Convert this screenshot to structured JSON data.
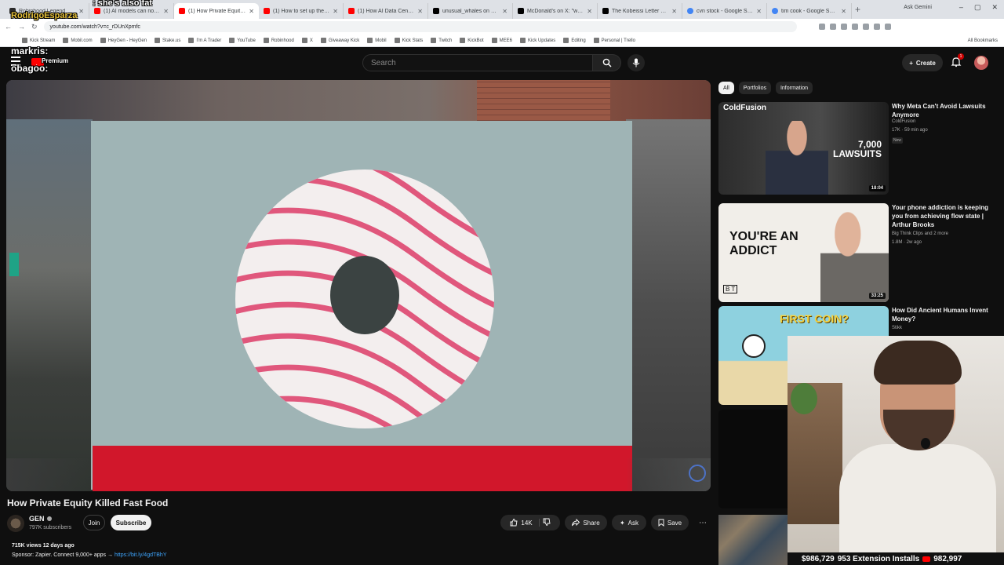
{
  "browser": {
    "tabs": [
      {
        "label": "Robinhood Legend",
        "icon": "robinhood-favicon"
      },
      {
        "label": "(1) AI models can now help",
        "icon": "youtube-favicon"
      },
      {
        "label": "(1) How Private Equity Killi",
        "icon": "youtube-favicon",
        "active": true
      },
      {
        "label": "(1) How to set up the Appl",
        "icon": "youtube-favicon"
      },
      {
        "label": "(1) How AI Data Centers Ar",
        "icon": "youtube-favicon"
      },
      {
        "label": "unusual_whales on X: \"GTI",
        "icon": "x-favicon"
      },
      {
        "label": "McDonald's on X: \"we've M",
        "icon": "x-favicon"
      },
      {
        "label": "The Kobeissi Letter on X",
        "icon": "x-favicon"
      },
      {
        "label": "cvn stock - Google Search",
        "icon": "google-favicon"
      },
      {
        "label": "tim cook - Google Search",
        "icon": "google-favicon"
      }
    ],
    "ask_gemini": "Ask Gemini",
    "url": "youtube.com/watch?v=c_rDUnXpmfc",
    "bookmarks": [
      "Kick Stream",
      "Mobil.com",
      "HeyGen - HeyGen",
      "Stake.us",
      "I'm A Trader",
      "YouTube",
      "Robinhood",
      "X",
      "Giveaway Kick",
      "Mobil",
      "Kick Stats",
      "Twitch",
      "KickBot",
      "MEE6",
      "Kick Updates",
      "Editing",
      "Personal | Trello"
    ],
    "all_bookmarks": "All Bookmarks"
  },
  "overlay": {
    "line1": ": she's also fat",
    "line2": "RodrigoEsparza",
    "line3": "markris:",
    "line4": "obagoo:",
    "premium": "Premium"
  },
  "header": {
    "search_placeholder": "Search",
    "create_label": "Create",
    "notification_count": "1"
  },
  "video": {
    "title": "How Private Equity Killed Fast Food",
    "channel": "GEN",
    "subscribers": "797K subscribers",
    "join_label": "Join",
    "subscribe_label": "Subscribe",
    "likes": "14K",
    "share_label": "Share",
    "ask_label": "Ask",
    "save_label": "Save",
    "stats": "715K views  12 days ago",
    "description_text": "Sponsor: Zapier. Connect 9,000+ apps → ",
    "description_link": "https://bit.ly/4gdTBhY"
  },
  "chips": [
    "All",
    "Portfolios",
    "Information"
  ],
  "recommendations": [
    {
      "title": "Why Meta Can't Avoid Lawsuits Anymore",
      "channel": "ColdFusion",
      "meta": "17K · 59 min ago",
      "badge": "New",
      "duration": "18:04",
      "thumb_text_brand": "ColdFusion",
      "thumb_text_a": "7,000",
      "thumb_text_b": "LAWSUITS"
    },
    {
      "title": "Your phone addiction is keeping you from achieving flow state | Arthur Brooks",
      "channel": "Big Think Clips and 2 more",
      "meta": "1.8M · 2w ago",
      "duration": "33:25",
      "thumb_text": "YOU'RE AN ADDICT",
      "thumb_logo": "B T"
    },
    {
      "title": "How Did Ancient Humans Invent Money?",
      "channel": "Stikk",
      "thumb_text": "FIRST COIN?"
    }
  ],
  "stream_footer": {
    "text_a": "$986,729",
    "text_b": "953 Extension Installs",
    "text_c": "982,997"
  },
  "colors": {
    "youtube_red": "#ff0000",
    "link_blue": "#3ea6ff",
    "background": "#0f0f0f"
  }
}
